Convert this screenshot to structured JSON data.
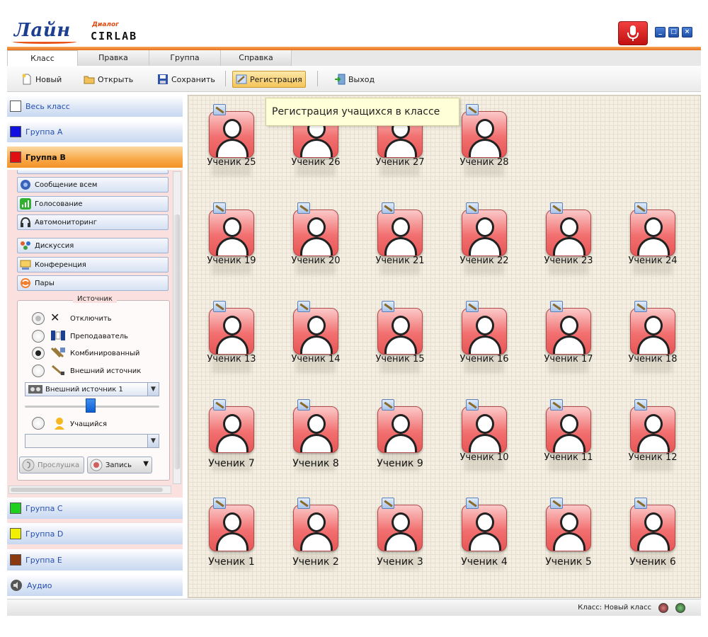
{
  "app": {
    "logo_main": "Лайн",
    "logo_dialog": "Диалог",
    "logo_cirlab": "CIRLAB"
  },
  "window_buttons": [
    "_",
    "□",
    "×"
  ],
  "tabs": [
    {
      "label": "Класс",
      "active": true
    },
    {
      "label": "Правка",
      "active": false
    },
    {
      "label": "Группа",
      "active": false
    },
    {
      "label": "Справка",
      "active": false
    }
  ],
  "toolbar": {
    "new_label": "Новый",
    "open_label": "Открыть",
    "save_label": "Сохранить",
    "register_label": "Регистрация",
    "exit_label": "Выход"
  },
  "sidebar": {
    "whole_class": "Весь класс",
    "groups": [
      {
        "label": "Группа A",
        "color": "#1010e0"
      },
      {
        "label": "Группа B",
        "color": "#e01010"
      },
      {
        "label": "Группа C",
        "color": "#20d020"
      },
      {
        "label": "Группа D",
        "color": "#f0f000"
      },
      {
        "label": "Группа E",
        "color": "#8b3a10"
      }
    ],
    "audio": "Аудио",
    "actions": [
      {
        "label": "Сообщение всем",
        "icon": "message-icon"
      },
      {
        "label": "Голосование",
        "icon": "vote-icon"
      },
      {
        "label": "Автомониторинг",
        "icon": "headphones-icon"
      },
      {
        "label": "Дискуссия",
        "icon": "discussion-icon"
      },
      {
        "label": "Конференция",
        "icon": "conference-icon"
      },
      {
        "label": "Пары",
        "icon": "pairs-icon"
      }
    ],
    "source": {
      "legend": "Источник",
      "options": [
        {
          "label": "Отключить",
          "state": "half"
        },
        {
          "label": "Преподаватель",
          "state": "off"
        },
        {
          "label": "Комбинированный",
          "state": "on"
        },
        {
          "label": "Внешний источник",
          "state": "off"
        }
      ],
      "external_select": "Внешний источник 1",
      "slider_level": 0.5,
      "student_label": "Учащийся",
      "student_select": "",
      "listen_label": "Прослушка",
      "record_label": "Запись"
    }
  },
  "tooltip": "Регистрация учащихся в классе",
  "students": {
    "rows": [
      [
        "Ученик 25",
        "Ученик 26",
        "Ученик 27",
        "Ученик 28"
      ],
      [
        "Ученик 19",
        "Ученик 20",
        "Ученик 21",
        "Ученик 22",
        "Ученик 23",
        "Ученик 24"
      ],
      [
        "Ученик 13",
        "Ученик 14",
        "Ученик 15",
        "Ученик 16",
        "Ученик 17",
        "Ученик 18"
      ],
      [
        "Ученик 7",
        "Ученик 8",
        "Ученик 9",
        "Ученик 10",
        "Ученик 11",
        "Ученик 12"
      ],
      [
        "Ученик 1",
        "Ученик 2",
        "Ученик 3",
        "Ученик 4",
        "Ученик 5",
        "Ученик 6"
      ]
    ]
  },
  "status": {
    "text": "Класс: Новый класс"
  },
  "colors": {
    "accent_orange": "#f39228",
    "student_card": "#f27070",
    "canvas_bg": "#f4efe2"
  }
}
